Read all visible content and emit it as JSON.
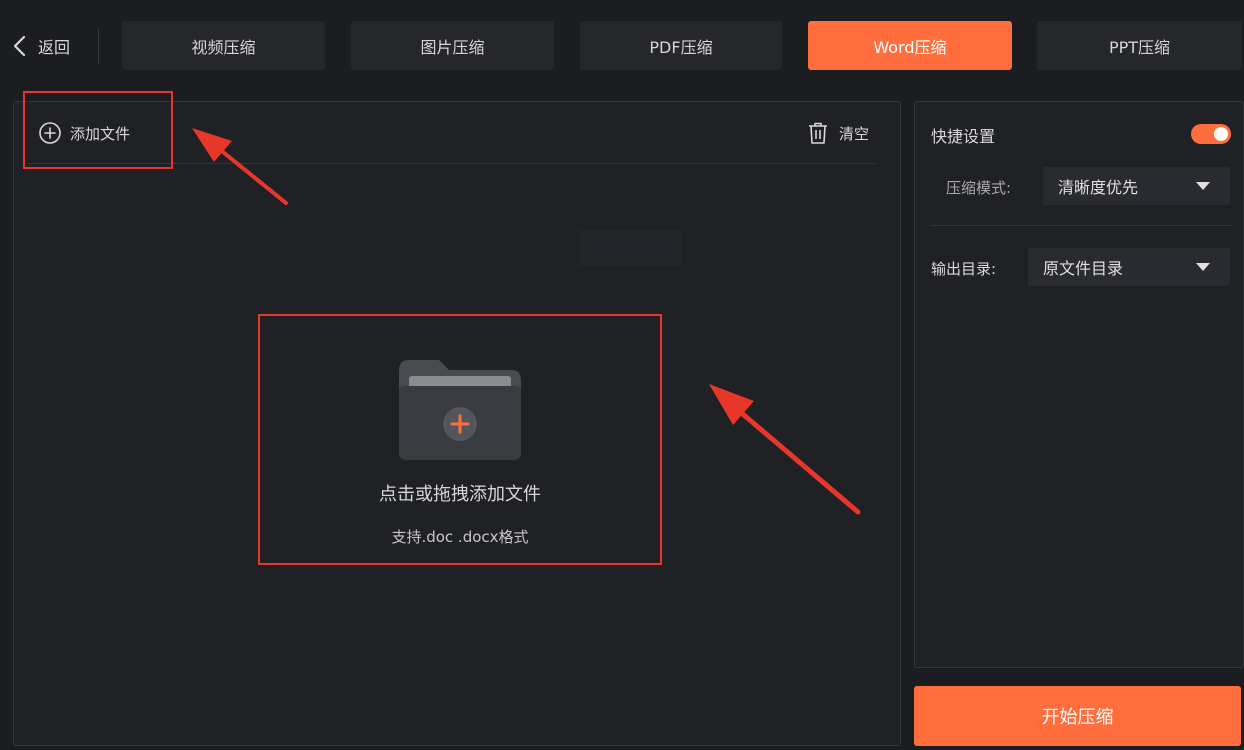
{
  "nav": {
    "back_label": "返回",
    "tabs": [
      {
        "label": "视频压缩",
        "active": false
      },
      {
        "label": "图片压缩",
        "active": false
      },
      {
        "label": "PDF压缩",
        "active": false
      },
      {
        "label": "Word压缩",
        "active": true
      },
      {
        "label": "PPT压缩",
        "active": false
      }
    ]
  },
  "toolbar": {
    "add_file_label": "添加文件",
    "clear_label": "清空"
  },
  "dropzone": {
    "title": "点击或拖拽添加文件",
    "formats": "支持.doc .docx格式"
  },
  "settings": {
    "quick_label": "快捷设置",
    "quick_enabled": true,
    "mode_label": "压缩模式:",
    "mode_value": "清晰度优先",
    "output_label": "输出目录:",
    "output_value": "原文件目录"
  },
  "start_label": "开始压缩",
  "colors": {
    "accent": "#ff6e3c",
    "annotation": "#e8372a",
    "background": "#1c1d20",
    "panel": "#202125"
  },
  "icons": [
    "chevron-left-icon",
    "plus-circle-icon",
    "trash-icon",
    "folder-add-icon",
    "chevron-down-icon"
  ]
}
